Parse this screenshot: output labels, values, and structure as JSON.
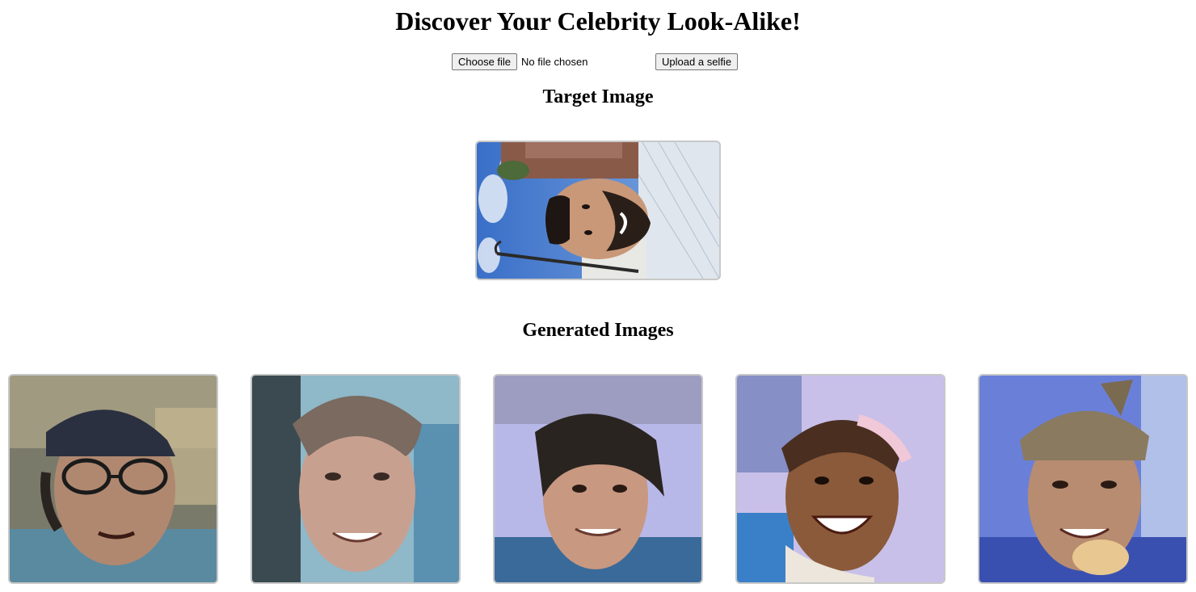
{
  "header": {
    "title": "Discover Your Celebrity Look-Alike!"
  },
  "upload": {
    "choose_file_label": "Choose file",
    "file_status": "No file chosen",
    "upload_button_label": "Upload a selfie"
  },
  "target_section": {
    "heading": "Target Image"
  },
  "generated_section": {
    "heading": "Generated Images",
    "count": 5
  },
  "colors": {
    "image_border": "#c8c8c8",
    "button_bg": "#efefef",
    "button_border": "#767676",
    "sky_blue": "#4a7fd0",
    "skin_tone": "#c89878",
    "lavender_bg": "#b8b8e8"
  }
}
